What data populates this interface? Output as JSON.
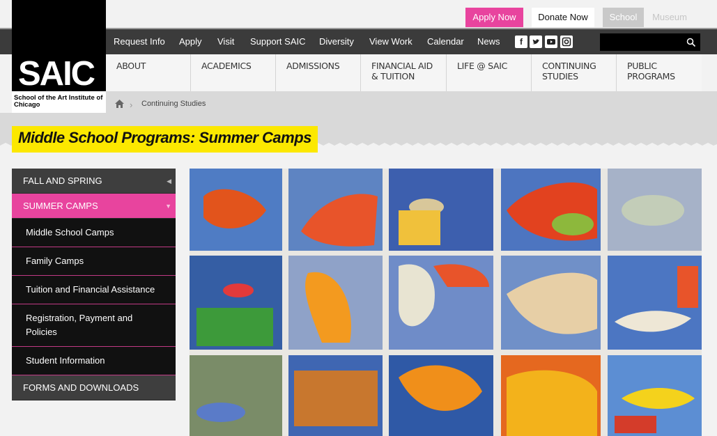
{
  "utility": {
    "apply_now": "Apply Now",
    "donate_now": "Donate Now",
    "school": "School",
    "museum": "Museum"
  },
  "top_nav": [
    "Request Info",
    "Apply",
    "Visit",
    "Support SAIC",
    "Diversity",
    "View Work",
    "Calendar",
    "News"
  ],
  "social": [
    "facebook-icon",
    "twitter-icon",
    "youtube-icon",
    "instagram-icon"
  ],
  "search": {
    "placeholder": ""
  },
  "logo": {
    "text": "SAIC",
    "subtitle": "School of the Art Institute of Chicago"
  },
  "main_nav": [
    "ABOUT",
    "ACADEMICS",
    "ADMISSIONS",
    "FINANCIAL AID & TUITION",
    "LIFE @ SAIC",
    "CONTINUING STUDIES",
    "PUBLIC PROGRAMS"
  ],
  "breadcrumb": {
    "current": "Continuing Studies"
  },
  "page_title": "Middle School Programs: Summer Camps",
  "sidebar": {
    "fall_spring": "FALL AND SPRING",
    "summer_camps": "SUMMER CAMPS",
    "sub_items": [
      "Middle School Camps",
      "Family Camps",
      "Tuition and Financial Assistance",
      "Registration, Payment and Policies",
      "Student Information"
    ],
    "forms": "FORMS AND DOWNLOADS"
  },
  "colors": {
    "accent_pink": "#e8449e",
    "title_yellow": "#fce800"
  }
}
